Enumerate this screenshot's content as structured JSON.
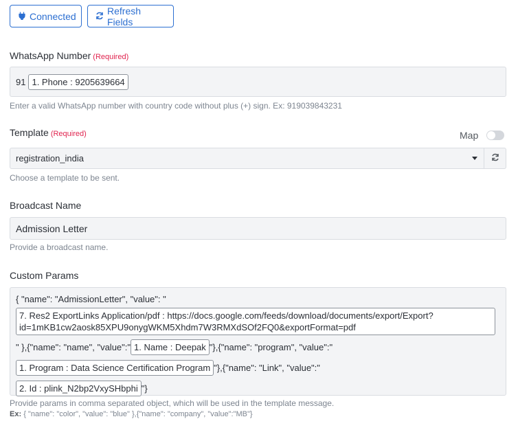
{
  "toolbar": {
    "connected_label": "Connected",
    "refresh_label": "Refresh Fields"
  },
  "whatsapp": {
    "label": "WhatsApp Number",
    "required": "(Required)",
    "prefix": "91",
    "token": "1. Phone : 9205639664",
    "help": "Enter a valid WhatsApp number with country code without plus (+) sign. Ex: 919039843231"
  },
  "template": {
    "label": "Template",
    "required": "(Required)",
    "map_label": "Map",
    "map_on": false,
    "selected": "registration_india",
    "help": "Choose a template to be sent."
  },
  "broadcast": {
    "label": "Broadcast Name",
    "value": "Admission Letter",
    "help": "Provide a broadcast name."
  },
  "custom_params": {
    "label": "Custom Params",
    "text1": "{ \"name\": \"AdmissionLetter\", \"value\": \"",
    "token1": "7. Res2 ExportLinks Application/pdf : https://docs.google.com/feeds/download/documents/export/Export?id=1mKB1cw2aosk85XPU9onygWKM5Xhdm7W3RMXdSOf2FQ0&exportFormat=pdf",
    "text2": "\" },{\"name\": \"name\", \"value\":\"",
    "token2": "1. Name : Deepak",
    "text3": "\"},{\"name\": \"program\", \"value\":\"",
    "token3": "1. Program : Data Science Certification Program",
    "text4": "\"},{\"name\": \"Link\", \"value\":\"",
    "token4": "2. Id : plink_N2bp2VxySHbphi",
    "text5": "\"}",
    "help": "Provide params in comma separated object, which will be used in the template message.",
    "example_label": "Ex:",
    "example": "{ \"name\": \"color\", \"value\": \"blue\" },{\"name\": \"company\", \"value\":\"MB\"}"
  },
  "colors": {
    "accent": "#2c6fd1",
    "required": "#e0234e"
  },
  "icons": {
    "connected": "plug-icon",
    "refresh": "refresh-icon"
  }
}
